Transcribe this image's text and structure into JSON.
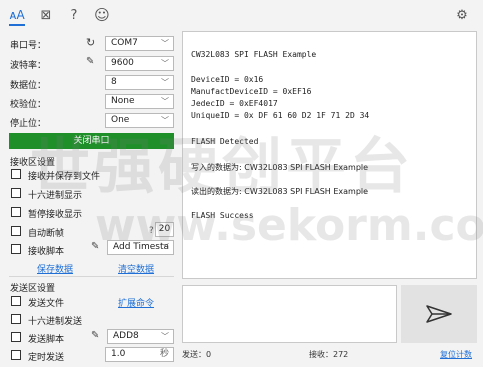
{
  "toolbar": {
    "icons": [
      "plot-icon",
      "help-icon",
      "emoji-icon",
      "settings-icon"
    ],
    "icon_glyphs": {
      "text": "ᴀA",
      "plot": "⊠",
      "help": "?",
      "emoji": "☺",
      "settings": "⚙"
    }
  },
  "serial": {
    "port_label": "串口号：",
    "port_value": "COM7",
    "baud_label": "波特率：",
    "baud_value": "9600",
    "databits_label": "数据位：",
    "databits_value": "8",
    "parity_label": "校验位：",
    "parity_value": "None",
    "stopbits_label": "停止位：",
    "stopbits_value": "One",
    "close_button": "关闭串口"
  },
  "receive": {
    "section_title": "接收区设置",
    "save_to_file": "接收并保存到文件",
    "hex_display": "十六进制显示",
    "pause_display": "暂停接收显示",
    "auto_newline": "自动断帧",
    "auto_newline_value": "20",
    "auto_newline_help": "?",
    "recv_script": "接收脚本",
    "recv_script_value": "Add Timesta",
    "save_data_link": "保存数据",
    "clear_data_link": "清空数据"
  },
  "send": {
    "section_title": "发送区设置",
    "send_file": "发送文件",
    "extended_cmd_link": "扩展命令",
    "hex_send": "十六进制发送",
    "send_script": "发送脚本",
    "send_script_value": "ADD8",
    "timed_send": "定时发送",
    "timed_value": "1.0",
    "timed_unit": "秒"
  },
  "output": {
    "lines": [
      "CW32L083 SPI FLASH Example",
      "",
      "DeviceID = 0x16",
      "ManufactDeviceID = 0xEF16",
      "JedecID = 0xEF4017",
      "UniqueID = 0x DF 61 60 D2 1F 71 2D 34",
      "",
      "FLASH Detected",
      "",
      "写入的数据为: CW32L083 SPI FLASH Example",
      "",
      "读出的数据为: CW32L083 SPI FLASH Example",
      "",
      "FLASH Success"
    ]
  },
  "status": {
    "sent": "发送：0",
    "received": "接收：272",
    "reset_link": "复位计数"
  },
  "watermark": {
    "cn": "世强硬创平台",
    "en": "www.sekorm.com"
  },
  "colors": {
    "accent": "#1f6fd6",
    "green_button": "#1f8f2a"
  }
}
